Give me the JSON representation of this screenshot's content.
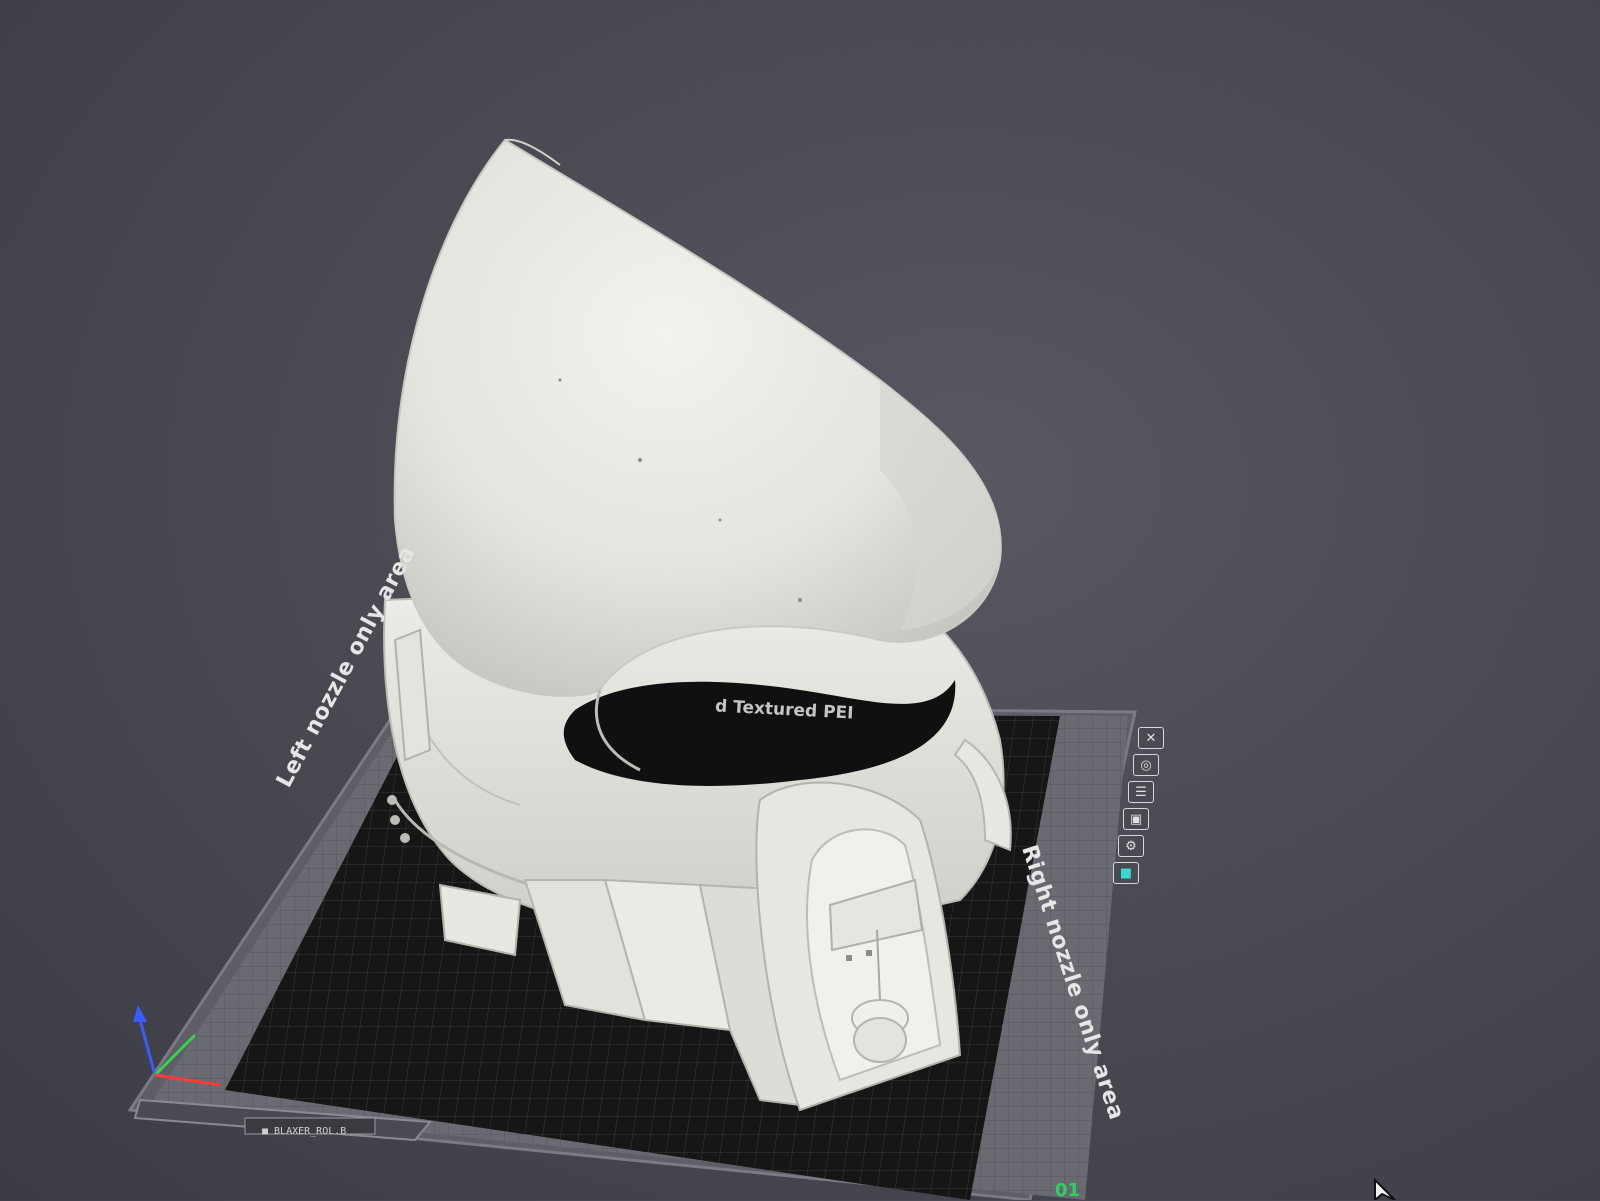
{
  "viewport": {
    "bed": {
      "left_area_label": "Left nozzle only area",
      "right_area_label": "Right nozzle only area",
      "plate_type_label": "d Textured PEI",
      "model_tag": "■ BLAXER_ROL.B",
      "plate_number": "01"
    },
    "plate_toolbar": [
      {
        "name": "close",
        "icon": "✕"
      },
      {
        "name": "auto-orient",
        "icon": "◎"
      },
      {
        "name": "arrange",
        "icon": "☰"
      },
      {
        "name": "lock",
        "icon": "▣"
      },
      {
        "name": "settings",
        "icon": "⚙"
      },
      {
        "name": "filament-color",
        "icon": "■"
      }
    ],
    "colors": {
      "background": "#4a4a53",
      "bed_grid": "#1b1b1b",
      "bed_frame": "#5e5e66",
      "model": "#ecebe6",
      "plate_number": "#2ed35f",
      "axis_x": "#ff3a3a",
      "axis_y": "#3bd14f",
      "axis_z": "#3a5bff"
    }
  }
}
